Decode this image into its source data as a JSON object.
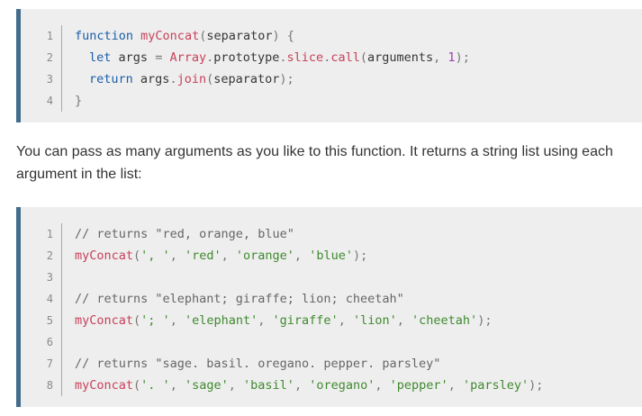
{
  "block1": {
    "lines": [
      {
        "n": "1",
        "t": [
          [
            "kw",
            "function"
          ],
          [
            "",
            ""
          ],
          [
            "fn",
            "myConcat"
          ],
          [
            "punc",
            "("
          ],
          [
            "",
            "separator"
          ],
          [
            "punc",
            ")"
          ],
          [
            "",
            ""
          ],
          [
            "punc",
            "{"
          ]
        ]
      },
      {
        "n": "2",
        "t": [
          [
            "kw",
            "let"
          ],
          [
            "",
            ""
          ],
          [
            "",
            "args"
          ],
          [
            "",
            ""
          ],
          [
            "punc",
            "="
          ],
          [
            "",
            ""
          ],
          [
            "fn",
            "Array"
          ],
          [
            "punc",
            "."
          ],
          [
            "",
            "prototype"
          ],
          [
            "punc",
            "."
          ],
          [
            "fn",
            "slice"
          ],
          [
            "punc",
            "."
          ],
          [
            "fn",
            "call"
          ],
          [
            "punc",
            "("
          ],
          [
            "",
            "arguments"
          ],
          [
            "punc",
            ","
          ],
          [
            "",
            ""
          ],
          [
            "num",
            "1"
          ],
          [
            "punc",
            ");"
          ]
        ]
      },
      {
        "n": "3",
        "t": [
          [
            "kw",
            "return"
          ],
          [
            "",
            ""
          ],
          [
            "",
            "args"
          ],
          [
            "punc",
            "."
          ],
          [
            "fn",
            "join"
          ],
          [
            "punc",
            "("
          ],
          [
            "",
            "separator"
          ],
          [
            "punc",
            ");"
          ]
        ]
      },
      {
        "n": "4",
        "t": [
          [
            "punc",
            "}"
          ]
        ]
      }
    ]
  },
  "prose": "You can pass as many arguments as you like to this function. It returns a string list using each argument in the list:",
  "block2": {
    "lines": [
      {
        "n": "1",
        "t": [
          [
            "cmt",
            "// returns \"red, orange, blue\""
          ]
        ]
      },
      {
        "n": "2",
        "t": [
          [
            "fn",
            "myConcat"
          ],
          [
            "punc",
            "("
          ],
          [
            "str",
            "', '"
          ],
          [
            "punc",
            ","
          ],
          [
            "",
            ""
          ],
          [
            "str",
            "'red'"
          ],
          [
            "punc",
            ","
          ],
          [
            "",
            ""
          ],
          [
            "str",
            "'orange'"
          ],
          [
            "punc",
            ","
          ],
          [
            "",
            ""
          ],
          [
            "str",
            "'blue'"
          ],
          [
            "punc",
            ");"
          ]
        ]
      },
      {
        "n": "3",
        "t": []
      },
      {
        "n": "4",
        "t": [
          [
            "cmt",
            "// returns \"elephant; giraffe; lion; cheetah\""
          ]
        ]
      },
      {
        "n": "5",
        "t": [
          [
            "fn",
            "myConcat"
          ],
          [
            "punc",
            "("
          ],
          [
            "str",
            "'; '"
          ],
          [
            "punc",
            ","
          ],
          [
            "",
            ""
          ],
          [
            "str",
            "'elephant'"
          ],
          [
            "punc",
            ","
          ],
          [
            "",
            ""
          ],
          [
            "str",
            "'giraffe'"
          ],
          [
            "punc",
            ","
          ],
          [
            "",
            ""
          ],
          [
            "str",
            "'lion'"
          ],
          [
            "punc",
            ","
          ],
          [
            "",
            ""
          ],
          [
            "str",
            "'cheetah'"
          ],
          [
            "punc",
            ");"
          ]
        ]
      },
      {
        "n": "6",
        "t": []
      },
      {
        "n": "7",
        "t": [
          [
            "cmt",
            "// returns \"sage. basil. oregano. pepper. parsley\""
          ]
        ]
      },
      {
        "n": "8",
        "t": [
          [
            "fn",
            "myConcat"
          ],
          [
            "punc",
            "("
          ],
          [
            "str",
            "'. '"
          ],
          [
            "punc",
            ","
          ],
          [
            "",
            ""
          ],
          [
            "str",
            "'sage'"
          ],
          [
            "punc",
            ","
          ],
          [
            "",
            ""
          ],
          [
            "str",
            "'basil'"
          ],
          [
            "punc",
            ","
          ],
          [
            "",
            ""
          ],
          [
            "str",
            "'oregano'"
          ],
          [
            "punc",
            ","
          ],
          [
            "",
            ""
          ],
          [
            "str",
            "'pepper'"
          ],
          [
            "punc",
            ","
          ],
          [
            "",
            ""
          ],
          [
            "str",
            "'parsley'"
          ],
          [
            "punc",
            ");"
          ]
        ]
      }
    ]
  }
}
